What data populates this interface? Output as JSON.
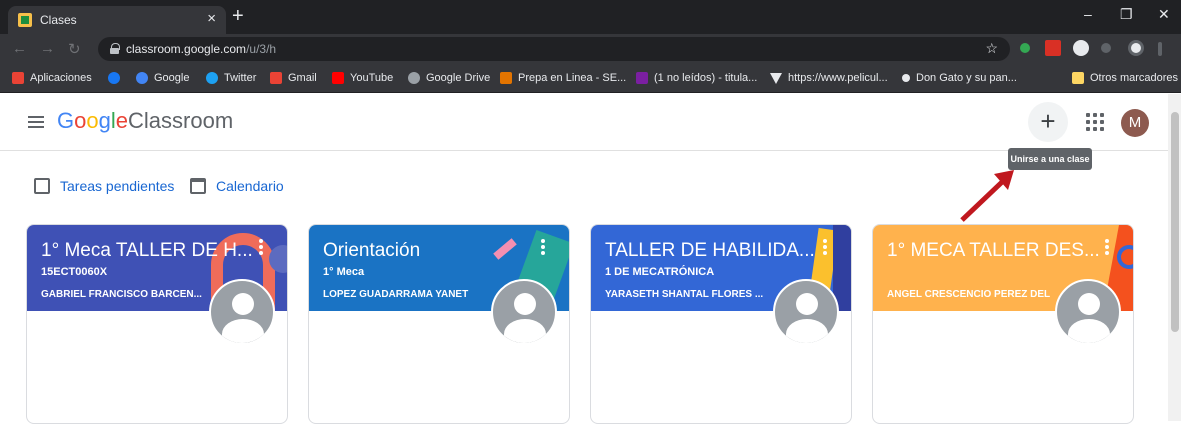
{
  "browser": {
    "tab_title": "Clases",
    "tab_close": "×",
    "new_tab": "+",
    "window_controls": [
      "–",
      "❐",
      "✕"
    ],
    "url_host": "classroom.google.com",
    "url_path": "/u/3/h",
    "bookmark_star": "☆",
    "bookmarks": [
      {
        "label": "Aplicaciones",
        "icon": "apps-grid-icon",
        "color": "#ea4335"
      },
      {
        "label": "",
        "icon": "facebook-icon",
        "color": "#1877f2"
      },
      {
        "label": "Google",
        "icon": "google-icon",
        "color": "#4285f4"
      },
      {
        "label": "Twitter",
        "icon": "twitter-icon",
        "color": "#1da1f2"
      },
      {
        "label": "Gmail",
        "icon": "gmail-icon",
        "color": "#ea4335"
      },
      {
        "label": "YouTube",
        "icon": "youtube-icon",
        "color": "#ff0000"
      },
      {
        "label": "Google Drive",
        "icon": "globe-icon",
        "color": "#9aa0a6"
      },
      {
        "label": "Prepa en Linea - SE...",
        "icon": "prepa-icon",
        "color": "#e37400"
      },
      {
        "label": "(1 no leídos) - titula...",
        "icon": "mail-icon",
        "color": "#7b1fa2"
      },
      {
        "label": "https://www.pelicul...",
        "icon": "triangle-icon",
        "color": "#e8eaed"
      },
      {
        "label": "Don Gato y su pan...",
        "icon": "dot-icon",
        "color": "#e8eaed"
      },
      {
        "label": "Otros marcadores",
        "icon": "folder-icon",
        "color": "#fdd663"
      }
    ]
  },
  "app": {
    "logo_google": [
      "G",
      "o",
      "o",
      "g",
      "l",
      "e"
    ],
    "logo_word": "Classroom",
    "plus_label": "+",
    "avatar_initial": "M",
    "tooltip": "Unirse a una clase",
    "quick_links": [
      "Tareas pendientes",
      "Calendario"
    ]
  },
  "cards": [
    {
      "title": "1° Meca TALLER DE H...",
      "section": "15ECT0060X",
      "teacher": "GABRIEL FRANCISCO BARCEN...",
      "color": "#3f51b5"
    },
    {
      "title": "Orientación",
      "section": "1° Meca",
      "teacher": "LOPEZ GUADARRAMA YANET",
      "color": "#1a73c4"
    },
    {
      "title": "TALLER DE HABILIDA...",
      "section": "1 DE MECATRÓNICA",
      "teacher": "YARASETH SHANTAL FLORES ...",
      "color": "#3367d6"
    },
    {
      "title": "1° MECA TALLER DES...",
      "section": "",
      "teacher": "ANGEL CRESCENCIO PEREZ DEL",
      "color": "#ffb24d"
    }
  ]
}
